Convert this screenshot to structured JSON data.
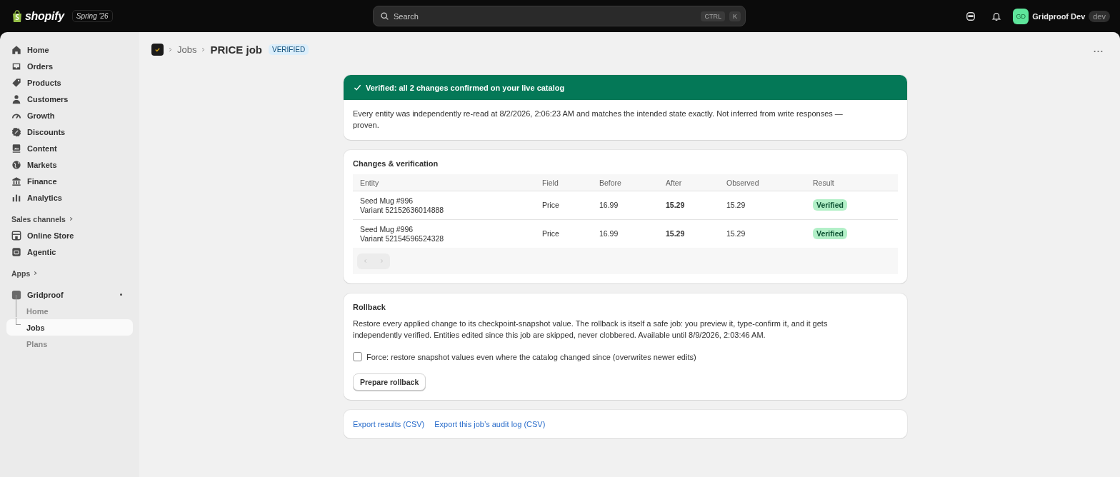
{
  "topbar": {
    "logo_text": "shopify",
    "edition": "Spring '26",
    "search": {
      "placeholder": "Search",
      "keys": [
        "CTRL",
        "K"
      ]
    },
    "user": {
      "initials": "GD",
      "name": "Gridproof Dev",
      "badge": "dev"
    }
  },
  "sidebar": {
    "items": [
      {
        "label": "Home",
        "selected": false
      },
      {
        "label": "Orders",
        "selected": false
      },
      {
        "label": "Products",
        "selected": false
      },
      {
        "label": "Customers",
        "selected": false
      },
      {
        "label": "Growth",
        "selected": false
      },
      {
        "label": "Discounts",
        "selected": false
      },
      {
        "label": "Content",
        "selected": false
      },
      {
        "label": "Markets",
        "selected": false
      },
      {
        "label": "Finance",
        "selected": false
      },
      {
        "label": "Analytics",
        "selected": false
      }
    ],
    "sales_channels": {
      "title": "Sales channels",
      "items": [
        {
          "label": "Online Store",
          "selected": false
        },
        {
          "label": "Agentic",
          "selected": false
        }
      ]
    },
    "apps": {
      "title": "Apps",
      "app": {
        "name": "Gridproof",
        "children": [
          {
            "label": "Home",
            "selected": false
          },
          {
            "label": "Jobs",
            "selected": true
          },
          {
            "label": "Plans",
            "selected": false
          }
        ]
      }
    }
  },
  "page": {
    "breadcrumb": "Jobs",
    "title": "PRICE job",
    "status": "VERIFIED"
  },
  "banner": {
    "title": "Verified: all 2 changes confirmed on your live catalog",
    "body": "Every entity was independently re-read at 8/2/2026, 2:06:23 AM and matches the intended state exactly. Not inferred from write responses — proven."
  },
  "changes": {
    "title": "Changes & verification",
    "columns": [
      "Entity",
      "Field",
      "Before",
      "After",
      "Observed",
      "Result"
    ],
    "rows": [
      {
        "entity": "Seed Mug #996",
        "variant": "Variant 52152636014888",
        "field": "Price",
        "before": "16.99",
        "after": "15.29",
        "observed": "15.29",
        "result": "Verified"
      },
      {
        "entity": "Seed Mug #996",
        "variant": "Variant 52154596524328",
        "field": "Price",
        "before": "16.99",
        "after": "15.29",
        "observed": "15.29",
        "result": "Verified"
      }
    ],
    "pagination": {
      "previous_disabled": true,
      "next_disabled": true
    }
  },
  "rollback": {
    "title": "Rollback",
    "text": "Restore every applied change to its checkpoint-snapshot value. The rollback is itself a safe job: you preview it, type-confirm it, and it gets independently verified. Entities edited since this job are skipped, never clobbered. Available until 8/9/2026, 2:03:46 AM.",
    "force": {
      "label": "Force: restore snapshot values even where the catalog changed since (overwrites newer edits)",
      "checked": false
    },
    "button": "Prepare rollback"
  },
  "exports": [
    "Export results (CSV)",
    "Export this job’s audit log (CSV)"
  ]
}
